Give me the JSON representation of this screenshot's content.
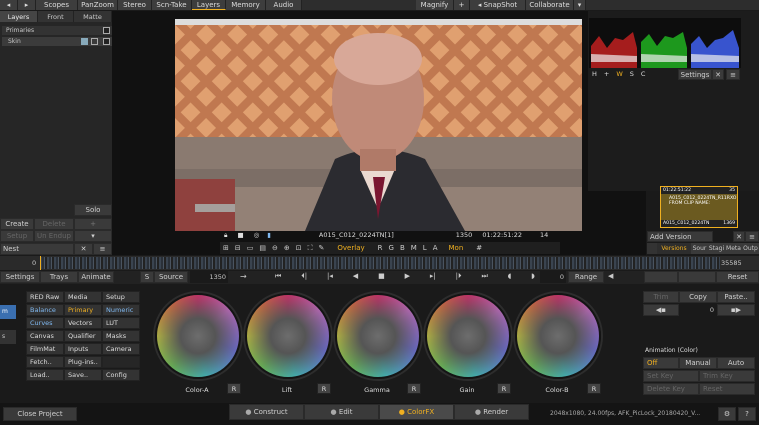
{
  "topbar": {
    "items": [
      "Scopes",
      "PanZoom",
      "Stereo",
      "Scn-Take",
      "Layers",
      "Memory",
      "Audio"
    ],
    "magnify": "Magnify",
    "snapshot": "SnapShot",
    "collaborate": "Collaborate"
  },
  "layers_panel": {
    "tabs": [
      "Layers",
      "Front",
      "Matte"
    ],
    "primaries": "Primaries",
    "skin": "Skin",
    "solo": "Solo",
    "create": "Create",
    "delete": "Delete",
    "setup": "Setup",
    "un_endup": "Un Endup",
    "nest": "Nest"
  },
  "viewer": {
    "clip_name": "A015_C012_0224TN[1]",
    "frame": "1350",
    "timecode": "01:22:51:22",
    "fps": "14",
    "overlay": "Overlay",
    "channels": [
      "R",
      "G",
      "B",
      "M",
      "L",
      "A"
    ],
    "mon": "Mon"
  },
  "scopes": {
    "buttons": [
      "H",
      "+",
      "W",
      "S",
      "C"
    ],
    "settings": "Settings"
  },
  "thumbnail": {
    "tc": "01:22:51:22",
    "num": "35",
    "line1": "A015_C012_0224TN_R11RXO",
    "line2": "FROM CLIP NAME:",
    "footer": "A015_C012_0224TN",
    "footer_num": "1369"
  },
  "versions": {
    "add_version": "Add Version",
    "tabs": [
      "Versions",
      "Sour",
      "Stagi",
      "Meta",
      "Outp"
    ]
  },
  "timeline": {
    "start": "0",
    "end": "35585"
  },
  "transport": {
    "settings": "Settings",
    "trays": "Trays",
    "animate": "Animate",
    "s": "S",
    "source": "Source",
    "frame": "1350",
    "zero": "0",
    "range": "Range",
    "reset": "Reset"
  },
  "menu": {
    "col1": [
      "RED Raw",
      "Balance",
      "Curves",
      "Canvas",
      "FilmMat",
      "Fetch..",
      "Load.."
    ],
    "col2": [
      "Media",
      "Primary",
      "Vectors",
      "Qualifier",
      "Inputs",
      "Plug-ins..",
      "Save.."
    ],
    "col3": [
      "Setup",
      "Numeric",
      "LUT",
      "Masks",
      "Camera",
      "",
      "Config"
    ]
  },
  "wheels": [
    "Color-A",
    "Lift",
    "Gamma",
    "Gain",
    "Color-B"
  ],
  "reset_label": "R",
  "right_panel": {
    "trim": "Trim",
    "copy": "Copy",
    "paste": "Paste..",
    "value": "0",
    "animation": "Animation (Color)",
    "off": "Off",
    "manual": "Manual",
    "auto": "Auto",
    "set_key": "Set Key",
    "trim_key": "Trim Key",
    "delete_key": "Delete Key",
    "reset": "Reset"
  },
  "bottom": {
    "close_project": "Close Project",
    "tabs": [
      "Construct",
      "Edit",
      "ColorFX",
      "Render"
    ],
    "status": "2048x1080, 24.00fps, AFK_PicLock_20180420_V..."
  },
  "colors": {
    "accent": "#f0b020",
    "blue_text": "#7fb8f0",
    "bg": "#1a1a1a"
  }
}
